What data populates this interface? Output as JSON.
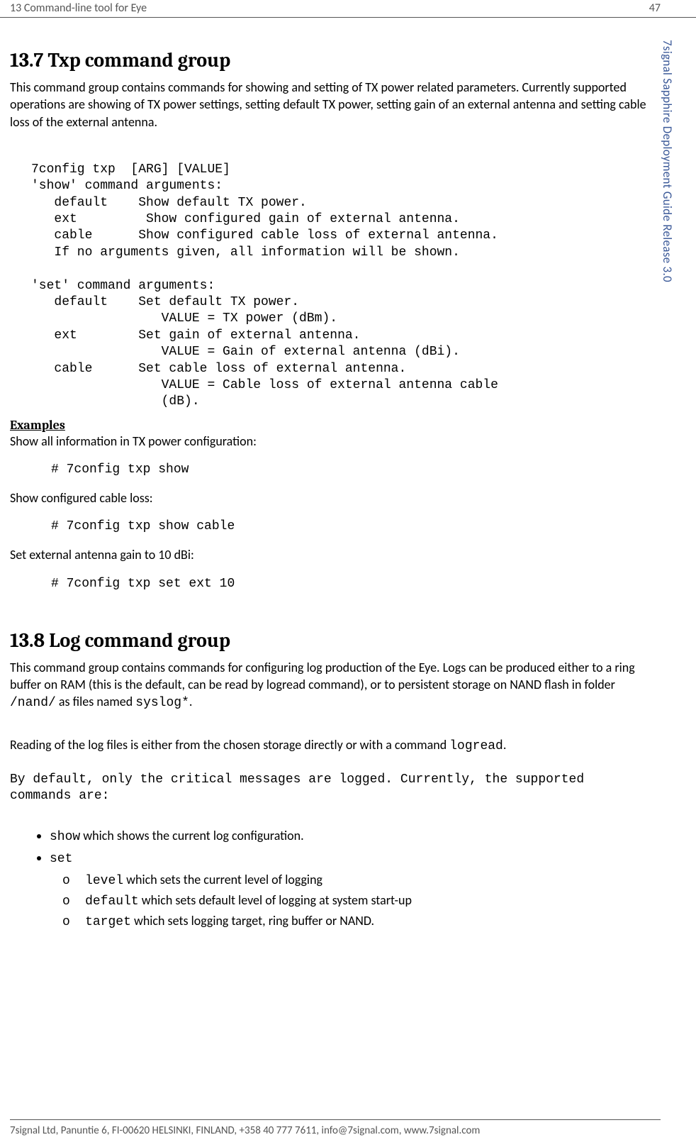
{
  "header": {
    "chapter": "13 Command-line tool for Eye",
    "page": "47"
  },
  "side_label": "7signal Sapphire Deployment Guide Release 3.0",
  "section_137": {
    "title": "13.7 Txp command group",
    "intro": "This command group contains commands for showing and setting of TX power related parameters. Currently supported operations are showing of TX power settings, setting default TX power, setting gain of an external antenna and setting cable loss of the external antenna.",
    "help_text": "7config txp  [ARG] [VALUE]\n'show' command arguments:\n   default    Show default TX power.\n   ext         Show configured gain of external antenna.\n   cable      Show configured cable loss of external antenna.\n   If no arguments given, all information will be shown.\n\n'set' command arguments:\n   default    Set default TX power.\n                 VALUE = TX power (dBm).\n   ext        Set gain of external antenna.\n                 VALUE = Gain of external antenna (dBi).\n   cable      Set cable loss of external antenna.\n                 VALUE = Cable loss of external antenna cable\n                 (dB).",
    "examples_heading": "Examples",
    "ex1_text": "Show all information in TX power configuration:",
    "ex1_cmd": "# 7config txp show",
    "ex2_text": "Show configured cable loss:",
    "ex2_cmd": "# 7config txp show cable",
    "ex3_text": "Set external antenna gain to 10 dBi:",
    "ex3_cmd": "# 7config txp set ext 10"
  },
  "section_138": {
    "title": "13.8 Log command group",
    "intro_part1": "This command group contains commands for configuring log production of the Eye. Logs can be produced either to a ring buffer on RAM (this is the default, can be read by logread command), or to persistent storage on NAND flash in folder ",
    "intro_folder": "/nand/",
    "intro_part2": " as files named ",
    "intro_files": "syslog*",
    "intro_part3": ".",
    "reading_part1": "Reading of the log files is either from the chosen storage directly or with a command ",
    "reading_cmd": "logread",
    "reading_part2": ".",
    "default_msg": "By default, only the critical messages are logged. Currently, the supported commands are:",
    "bullets": {
      "show_cmd": "show",
      "show_text": " which shows the current log configuration.",
      "set_cmd": "set",
      "level_cmd": "level",
      "level_text": " which sets the current level of logging",
      "default_cmd": "default",
      "default_text": " which sets default level of logging at system start-up",
      "target_cmd": "target",
      "target_text": " which sets logging target, ring buffer or NAND."
    }
  },
  "footer": "7signal Ltd, Panuntie 6, FI-00620 HELSINKI, FINLAND, +358 40 777 7611, info@7signal.com, www.7signal.com"
}
